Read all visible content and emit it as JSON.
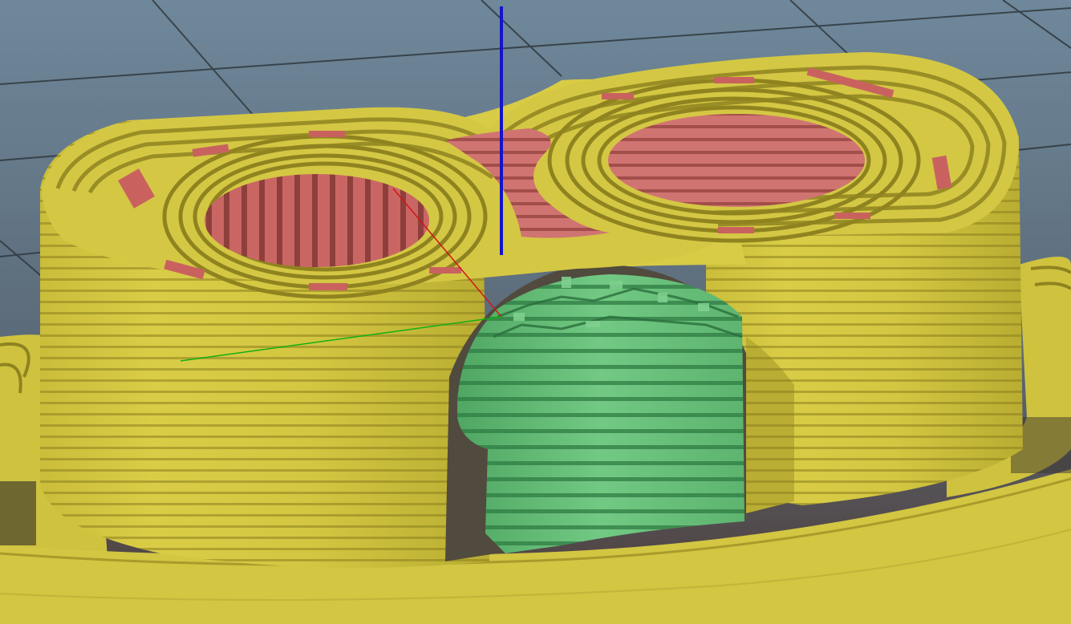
{
  "viewport": {
    "kind": "3d-slicer-gcode-preview",
    "colors": {
      "background_top": "#6b8396",
      "background_bottom": "#4a3a36",
      "grid_line": "#2b3338",
      "perimeter": "#d9cc45",
      "perimeter_shadow": "#8f8320",
      "infill": "#cf6f6c",
      "infill_shadow": "#8e3f3c",
      "support": "#6cc27c",
      "support_shadow": "#2f7a44",
      "axis_x": "#d01818",
      "axis_y": "#12b012",
      "axis_z": "#1414c8"
    },
    "features": [
      "perimeter",
      "infill",
      "support-material",
      "skirt"
    ],
    "axes": [
      "x-axis",
      "y-axis",
      "z-axis"
    ]
  }
}
